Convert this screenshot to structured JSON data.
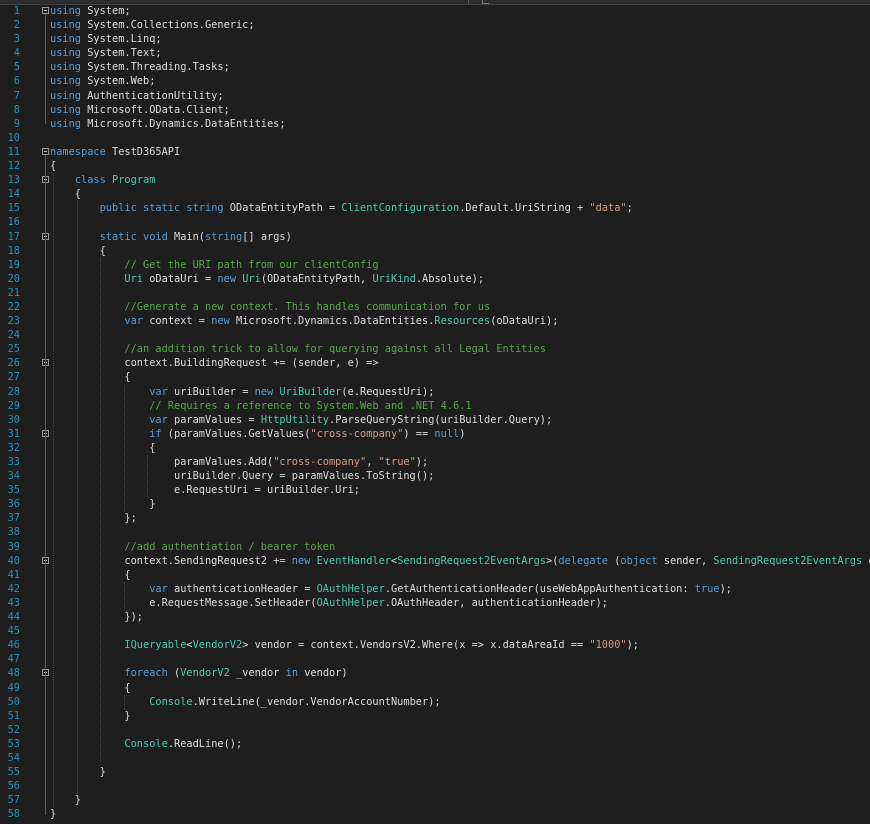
{
  "editor": {
    "lines": [
      {
        "n": "1",
        "fold": true,
        "tokens": [
          [
            "k",
            "using"
          ],
          [
            "p",
            " System;"
          ]
        ]
      },
      {
        "n": "2",
        "fold": false,
        "tokens": [
          [
            "k",
            "using"
          ],
          [
            "p",
            " System.Collections.Generic;"
          ]
        ]
      },
      {
        "n": "3",
        "fold": false,
        "tokens": [
          [
            "k",
            "using"
          ],
          [
            "p",
            " System.Linq;"
          ]
        ]
      },
      {
        "n": "4",
        "fold": false,
        "tokens": [
          [
            "k",
            "using"
          ],
          [
            "p",
            " System.Text;"
          ]
        ]
      },
      {
        "n": "5",
        "fold": false,
        "tokens": [
          [
            "k",
            "using"
          ],
          [
            "p",
            " System.Threading.Tasks;"
          ]
        ]
      },
      {
        "n": "6",
        "fold": false,
        "tokens": [
          [
            "k",
            "using"
          ],
          [
            "p",
            " System.Web;"
          ]
        ]
      },
      {
        "n": "7",
        "fold": false,
        "tokens": [
          [
            "k",
            "using"
          ],
          [
            "p",
            " AuthenticationUtility;"
          ]
        ]
      },
      {
        "n": "8",
        "fold": false,
        "tokens": [
          [
            "k",
            "using"
          ],
          [
            "p",
            " Microsoft.OData.Client;"
          ]
        ]
      },
      {
        "n": "9",
        "fold": false,
        "tokens": [
          [
            "k",
            "using"
          ],
          [
            "p",
            " Microsoft.Dynamics.DataEntities;"
          ]
        ]
      },
      {
        "n": "10",
        "fold": false,
        "tokens": []
      },
      {
        "n": "11",
        "fold": true,
        "tokens": [
          [
            "k",
            "namespace"
          ],
          [
            "p",
            " TestD365API"
          ]
        ]
      },
      {
        "n": "12",
        "fold": false,
        "tokens": [
          [
            "p",
            "{"
          ]
        ]
      },
      {
        "n": "13",
        "fold": true,
        "tokens": [
          [
            "p",
            "    "
          ],
          [
            "k",
            "class"
          ],
          [
            "p",
            " "
          ],
          [
            "t",
            "Program"
          ]
        ]
      },
      {
        "n": "14",
        "fold": false,
        "tokens": [
          [
            "p",
            "    {"
          ]
        ]
      },
      {
        "n": "15",
        "fold": false,
        "tokens": [
          [
            "p",
            "        "
          ],
          [
            "k",
            "public static string"
          ],
          [
            "p",
            " ODataEntityPath = "
          ],
          [
            "t",
            "ClientConfiguration"
          ],
          [
            "p",
            ".Default.UriString + "
          ],
          [
            "s",
            "\"data\""
          ],
          [
            "p",
            ";"
          ]
        ]
      },
      {
        "n": "16",
        "fold": false,
        "tokens": []
      },
      {
        "n": "17",
        "fold": true,
        "tokens": [
          [
            "p",
            "        "
          ],
          [
            "k",
            "static void"
          ],
          [
            "p",
            " Main("
          ],
          [
            "k",
            "string"
          ],
          [
            "p",
            "[] args)"
          ]
        ]
      },
      {
        "n": "18",
        "fold": false,
        "tokens": [
          [
            "p",
            "        {"
          ]
        ]
      },
      {
        "n": "19",
        "fold": false,
        "tokens": [
          [
            "p",
            "            "
          ],
          [
            "c",
            "// Get the URI path from our clientConfig"
          ]
        ]
      },
      {
        "n": "20",
        "fold": false,
        "tokens": [
          [
            "p",
            "            "
          ],
          [
            "t",
            "Uri"
          ],
          [
            "p",
            " oDataUri = "
          ],
          [
            "k",
            "new"
          ],
          [
            "p",
            " "
          ],
          [
            "t",
            "Uri"
          ],
          [
            "p",
            "(ODataEntityPath, "
          ],
          [
            "t",
            "UriKind"
          ],
          [
            "p",
            ".Absolute);"
          ]
        ]
      },
      {
        "n": "21",
        "fold": false,
        "tokens": []
      },
      {
        "n": "22",
        "fold": false,
        "tokens": [
          [
            "p",
            "            "
          ],
          [
            "c",
            "//Generate a new context. This handles communication for us"
          ]
        ]
      },
      {
        "n": "23",
        "fold": false,
        "tokens": [
          [
            "p",
            "            "
          ],
          [
            "k",
            "var"
          ],
          [
            "p",
            " context = "
          ],
          [
            "k",
            "new"
          ],
          [
            "p",
            " Microsoft.Dynamics.DataEntities."
          ],
          [
            "t",
            "Resources"
          ],
          [
            "p",
            "(oDataUri);"
          ]
        ]
      },
      {
        "n": "24",
        "fold": false,
        "tokens": []
      },
      {
        "n": "25",
        "fold": false,
        "tokens": [
          [
            "p",
            "            "
          ],
          [
            "c",
            "//an addition trick to allow for querying against all Legal Entities"
          ]
        ]
      },
      {
        "n": "26",
        "fold": true,
        "tokens": [
          [
            "p",
            "            context.BuildingRequest += (sender, e) =>"
          ]
        ]
      },
      {
        "n": "27",
        "fold": false,
        "tokens": [
          [
            "p",
            "            {"
          ]
        ]
      },
      {
        "n": "28",
        "fold": false,
        "tokens": [
          [
            "p",
            "                "
          ],
          [
            "k",
            "var"
          ],
          [
            "p",
            " uriBuilder = "
          ],
          [
            "k",
            "new"
          ],
          [
            "p",
            " "
          ],
          [
            "t",
            "UriBuilder"
          ],
          [
            "p",
            "(e.RequestUri);"
          ]
        ]
      },
      {
        "n": "29",
        "fold": false,
        "tokens": [
          [
            "p",
            "                "
          ],
          [
            "c",
            "// Requires a reference to System.Web and .NET 4.6.1"
          ]
        ]
      },
      {
        "n": "30",
        "fold": false,
        "tokens": [
          [
            "p",
            "                "
          ],
          [
            "k",
            "var"
          ],
          [
            "p",
            " paramValues = "
          ],
          [
            "t",
            "HttpUtility"
          ],
          [
            "p",
            ".ParseQueryString(uriBuilder.Query);"
          ]
        ]
      },
      {
        "n": "31",
        "fold": true,
        "tokens": [
          [
            "p",
            "                "
          ],
          [
            "k",
            "if"
          ],
          [
            "p",
            " (paramValues.GetValues("
          ],
          [
            "s",
            "\"cross-company\""
          ],
          [
            "p",
            ") == "
          ],
          [
            "k",
            "null"
          ],
          [
            "p",
            ")"
          ]
        ]
      },
      {
        "n": "32",
        "fold": false,
        "tokens": [
          [
            "p",
            "                {"
          ]
        ]
      },
      {
        "n": "33",
        "fold": false,
        "tokens": [
          [
            "p",
            "                    paramValues.Add("
          ],
          [
            "s",
            "\"cross-company\""
          ],
          [
            "p",
            ", "
          ],
          [
            "s",
            "\"true\""
          ],
          [
            "p",
            ");"
          ]
        ]
      },
      {
        "n": "34",
        "fold": false,
        "tokens": [
          [
            "p",
            "                    uriBuilder.Query = paramValues.ToString();"
          ]
        ]
      },
      {
        "n": "35",
        "fold": false,
        "tokens": [
          [
            "p",
            "                    e.RequestUri = uriBuilder.Uri;"
          ]
        ]
      },
      {
        "n": "36",
        "fold": false,
        "tokens": [
          [
            "p",
            "                }"
          ]
        ]
      },
      {
        "n": "37",
        "fold": false,
        "tokens": [
          [
            "p",
            "            };"
          ]
        ]
      },
      {
        "n": "38",
        "fold": false,
        "tokens": []
      },
      {
        "n": "39",
        "fold": false,
        "tokens": [
          [
            "p",
            "            "
          ],
          [
            "c",
            "//add authentiation / bearer token"
          ]
        ]
      },
      {
        "n": "40",
        "fold": true,
        "tokens": [
          [
            "p",
            "            context.SendingRequest2 += "
          ],
          [
            "k",
            "new"
          ],
          [
            "p",
            " "
          ],
          [
            "t",
            "EventHandler"
          ],
          [
            "p",
            "<"
          ],
          [
            "t",
            "SendingRequest2EventArgs"
          ],
          [
            "p",
            ">("
          ],
          [
            "k",
            "delegate"
          ],
          [
            "p",
            " ("
          ],
          [
            "k",
            "object"
          ],
          [
            "p",
            " sender, "
          ],
          [
            "t",
            "SendingRequest2EventArgs"
          ],
          [
            "p",
            " e)"
          ]
        ]
      },
      {
        "n": "41",
        "fold": false,
        "tokens": [
          [
            "p",
            "            {"
          ]
        ]
      },
      {
        "n": "42",
        "fold": false,
        "tokens": [
          [
            "p",
            "                "
          ],
          [
            "k",
            "var"
          ],
          [
            "p",
            " authenticationHeader = "
          ],
          [
            "t",
            "OAuthHelper"
          ],
          [
            "p",
            ".GetAuthenticationHeader(useWebAppAuthentication: "
          ],
          [
            "k",
            "true"
          ],
          [
            "p",
            ");"
          ]
        ]
      },
      {
        "n": "43",
        "fold": false,
        "tokens": [
          [
            "p",
            "                e.RequestMessage.SetHeader("
          ],
          [
            "t",
            "OAuthHelper"
          ],
          [
            "p",
            ".OAuthHeader, authenticationHeader);"
          ]
        ]
      },
      {
        "n": "44",
        "fold": false,
        "tokens": [
          [
            "p",
            "            });"
          ]
        ]
      },
      {
        "n": "45",
        "fold": false,
        "tokens": []
      },
      {
        "n": "46",
        "fold": false,
        "tokens": [
          [
            "p",
            "            "
          ],
          [
            "t",
            "IQueryable"
          ],
          [
            "p",
            "<"
          ],
          [
            "t",
            "VendorV2"
          ],
          [
            "p",
            "> vendor = context.VendorsV2.Where(x => x.dataAreaId == "
          ],
          [
            "s",
            "\"1000\""
          ],
          [
            "p",
            ");"
          ]
        ]
      },
      {
        "n": "47",
        "fold": false,
        "tokens": []
      },
      {
        "n": "48",
        "fold": true,
        "tokens": [
          [
            "p",
            "            "
          ],
          [
            "k",
            "foreach"
          ],
          [
            "p",
            " ("
          ],
          [
            "t",
            "VendorV2"
          ],
          [
            "p",
            " _vendor "
          ],
          [
            "k",
            "in"
          ],
          [
            "p",
            " vendor)"
          ]
        ]
      },
      {
        "n": "49",
        "fold": false,
        "tokens": [
          [
            "p",
            "            {"
          ]
        ]
      },
      {
        "n": "50",
        "fold": false,
        "tokens": [
          [
            "p",
            "                "
          ],
          [
            "t",
            "Console"
          ],
          [
            "p",
            ".WriteLine(_vendor.VendorAccountNumber);"
          ]
        ]
      },
      {
        "n": "51",
        "fold": false,
        "tokens": [
          [
            "p",
            "            }"
          ]
        ]
      },
      {
        "n": "52",
        "fold": false,
        "tokens": []
      },
      {
        "n": "53",
        "fold": false,
        "tokens": [
          [
            "p",
            "            "
          ],
          [
            "t",
            "Console"
          ],
          [
            "p",
            ".ReadLine();"
          ]
        ]
      },
      {
        "n": "54",
        "fold": false,
        "tokens": []
      },
      {
        "n": "55",
        "fold": false,
        "tokens": [
          [
            "p",
            "        }"
          ]
        ]
      },
      {
        "n": "56",
        "fold": false,
        "tokens": []
      },
      {
        "n": "57",
        "fold": false,
        "tokens": [
          [
            "p",
            "    }"
          ]
        ]
      },
      {
        "n": "58",
        "fold": false,
        "tokens": [
          [
            "p",
            "}"
          ]
        ]
      }
    ]
  }
}
